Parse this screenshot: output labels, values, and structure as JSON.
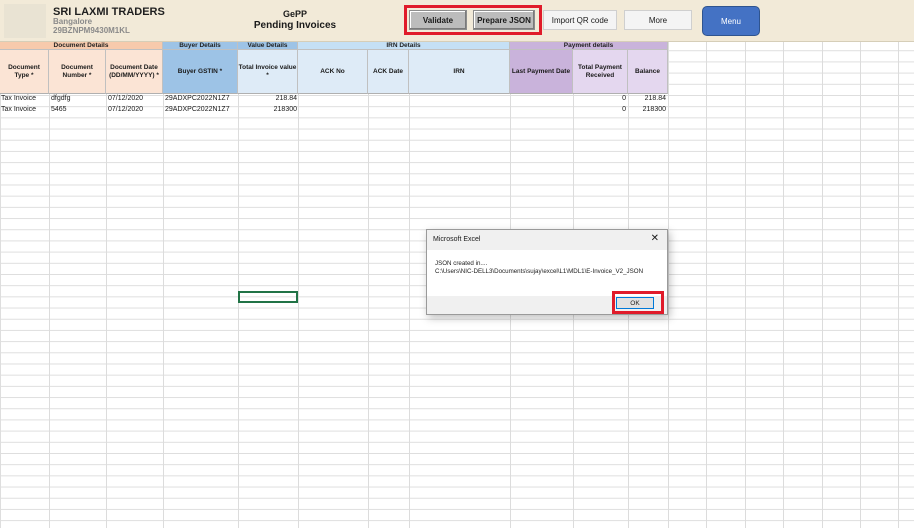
{
  "company": {
    "name": "SRI LAXMI TRADERS",
    "city": "Bangalore",
    "gstin": "29BZNPM9430M1KL"
  },
  "app": {
    "title": "GePP",
    "subtitle": "Pending Invoices"
  },
  "toolbar": {
    "validate_label": "Validate",
    "prepare_json_label": "Prepare JSON",
    "import_qr_label": "Import QR code",
    "more_label": "More",
    "menu_label": "Menu"
  },
  "groups": {
    "document_details": "Document Details",
    "buyer_details": "Buyer Details",
    "value_details": "Value Details",
    "irn_details": "IRN Details",
    "payment_details": "Payment details"
  },
  "columns": {
    "doc_type": "Document Type *",
    "doc_number": "Document Number *",
    "doc_date": "Document Date (DD/MM/YYYY) *",
    "buyer_gstin": "Buyer GSTIN *",
    "total_value": "Total Invoice value *",
    "ack_no": "ACK No",
    "ack_date": "ACK Date",
    "irn": "IRN",
    "last_payment_date": "Last Payment Date",
    "total_payment_received": "Total Payment Received",
    "balance": "Balance"
  },
  "rows": [
    {
      "doc_type": "Tax Invoice",
      "doc_number": "dfgdfg",
      "doc_date": "07/12/2020",
      "buyer_gstin": "29ADXPC2022N1Z7",
      "total_value": "218.84",
      "ack_no": "",
      "ack_date": "",
      "irn": "",
      "last_payment_date": "",
      "total_payment_received": "0",
      "balance": "218.84"
    },
    {
      "doc_type": "Tax Invoice",
      "doc_number": "5465",
      "doc_date": "07/12/2020",
      "buyer_gstin": "29ADXPC2022N1Z7",
      "total_value": "218300",
      "ack_no": "",
      "ack_date": "",
      "irn": "",
      "last_payment_date": "",
      "total_payment_received": "0",
      "balance": "218300"
    }
  ],
  "dialog": {
    "title": "Microsoft Excel",
    "close_glyph": "✕",
    "message_line1": "JSON created in....",
    "message_line2": "C:\\Users\\NIC-DELL3\\Documents\\sujay\\excel\\L1\\MDL1\\E-Invoice_V2_JSON",
    "ok_label": "OK"
  },
  "colors": {
    "highlight": "#e01b2a",
    "menu_button": "#4472c4",
    "banner": "#f2ead8"
  }
}
